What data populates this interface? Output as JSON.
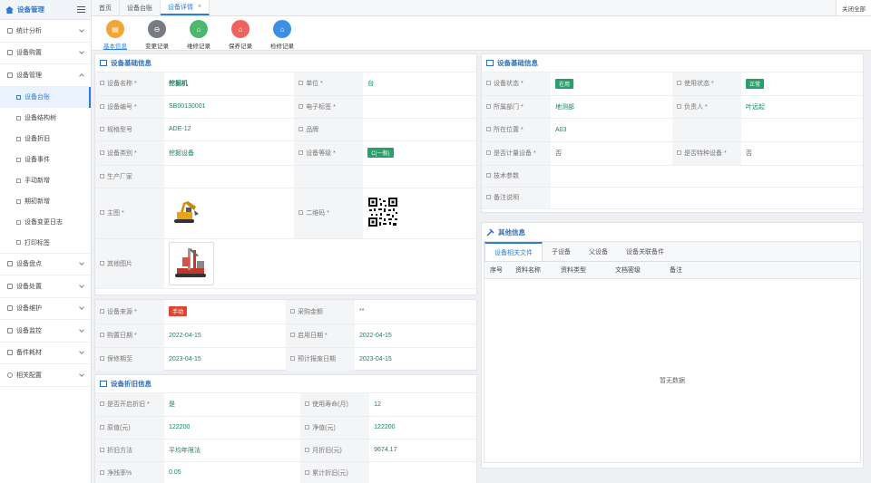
{
  "sidebar": {
    "title": "设备管理",
    "items": [
      {
        "label": "统计分析"
      },
      {
        "label": "设备购置"
      },
      {
        "label": "设备管理"
      }
    ],
    "sub_items": [
      {
        "label": "设备台账"
      },
      {
        "label": "设备结构树"
      },
      {
        "label": "设备折旧"
      },
      {
        "label": "设备事件"
      },
      {
        "label": "手动新增"
      },
      {
        "label": "期初新增"
      },
      {
        "label": "设备变更日志"
      },
      {
        "label": "打印标签"
      }
    ],
    "bottom_items": [
      {
        "label": "设备盘点"
      },
      {
        "label": "设备处置"
      },
      {
        "label": "设备维护"
      },
      {
        "label": "设备监控"
      },
      {
        "label": "备件耗材"
      },
      {
        "label": "相关配置"
      }
    ]
  },
  "tabs": [
    {
      "label": "首页"
    },
    {
      "label": "设备台账"
    },
    {
      "label": "设备详情",
      "close": "×"
    }
  ],
  "close_all": "关闭全部",
  "actions": [
    {
      "label": "基本信息",
      "color": "#f0a637"
    },
    {
      "label": "变更记录",
      "color": "#777b82"
    },
    {
      "label": "维修记录",
      "color": "#4cb86e"
    },
    {
      "label": "保养记录",
      "color": "#f0625e"
    },
    {
      "label": "检修记录",
      "color": "#3b8fe6"
    }
  ],
  "basic_left": {
    "title": "设备基础信息",
    "rows": [
      {
        "l1": "设备名称",
        "v1": "挖掘机",
        "l2": "单位",
        "v2": "台"
      },
      {
        "l1": "设备编号",
        "v1": "SB00130001",
        "l2": "电子标签",
        "v2": ""
      },
      {
        "l1": "规格型号",
        "v1": "ADE-12",
        "l2": "品牌",
        "v2": ""
      },
      {
        "l1": "设备类别",
        "v1": "挖掘设备",
        "l2": "设备等级",
        "v2": "C(一般)"
      },
      {
        "l1": "生产厂家",
        "v1": "",
        "l2": "",
        "v2": ""
      }
    ],
    "main_image_label": "主图",
    "qr_label": "二维码",
    "other_images_label": "其他图片"
  },
  "source": {
    "rows": [
      {
        "l1": "设备来源",
        "v1": "手动",
        "l2": "采购金额",
        "v2": "**"
      },
      {
        "l1": "购置日期",
        "v1": "2022-04-15",
        "l2": "启用日期",
        "v2": "2022-04-15"
      },
      {
        "l1": "保修期至",
        "v1": "2023-04-15",
        "l2": "预计报废日期",
        "v2": "2023-04-15"
      }
    ]
  },
  "depreciation": {
    "title": "设备折旧信息",
    "rows": [
      {
        "l1": "是否开启折旧",
        "v1": "是",
        "l2": "使用寿命(月)",
        "v2": "12"
      },
      {
        "l1": "原值(元)",
        "v1": "122200",
        "l2": "净值(元)",
        "v2": "122200"
      },
      {
        "l1": "折旧方法",
        "v1": "平均年限法",
        "l2": "月折旧(元)",
        "v2": "9674.17"
      },
      {
        "l1": "净残率%",
        "v1": "0.05",
        "l2": "累计折旧(元)",
        "v2": ""
      }
    ]
  },
  "basic_right": {
    "title": "设备基础信息",
    "rows": [
      {
        "l1": "设备状态",
        "v1": "在用",
        "l2": "使用状态",
        "v2": "正常"
      },
      {
        "l1": "所属部门",
        "v1": "地测部",
        "l2": "负责人",
        "v2": "叶远起"
      },
      {
        "l1": "所在位置",
        "v1": "A03",
        "l2": "",
        "v2": ""
      },
      {
        "l1": "是否计量设备",
        "v1": "否",
        "l2": "是否特种设备",
        "v2": "否"
      },
      {
        "l1": "技术参数",
        "v1": "",
        "l2": "",
        "v2": ""
      },
      {
        "l1": "备注说明",
        "v1": "",
        "l2": "",
        "v2": ""
      }
    ]
  },
  "other_info": {
    "title": "其他信息",
    "tabs": [
      {
        "label": "设备相关文件"
      },
      {
        "label": "子设备"
      },
      {
        "label": "父设备"
      },
      {
        "label": "设备关联备件"
      }
    ],
    "columns": [
      "序号",
      "资料名称",
      "资料类型",
      "文档密级",
      "备注"
    ],
    "empty_text": "暂无数据"
  },
  "colors": {
    "accent": "#2b7ed9",
    "value_green": "#1d7f5f",
    "badge_green": "#27a06b",
    "badge_red": "#e0452f"
  }
}
